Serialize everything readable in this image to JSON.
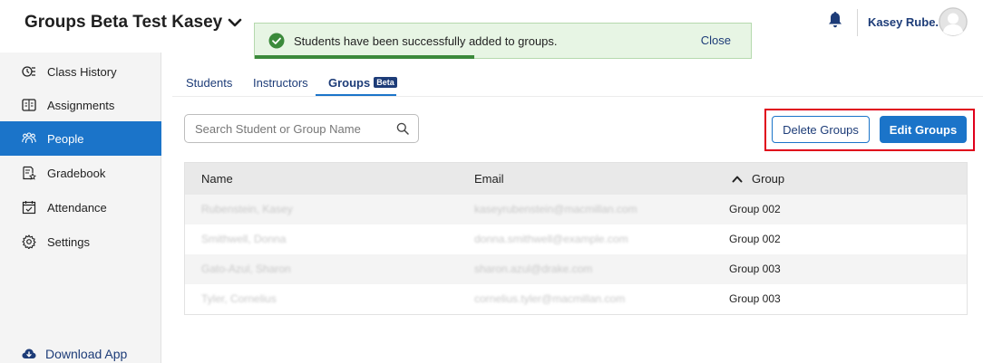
{
  "header": {
    "course_title": "Groups Beta Test Kasey",
    "user_name": "Kasey Rube..."
  },
  "toast": {
    "message": "Students have been successfully added to groups.",
    "close_label": "Close"
  },
  "sidebar": {
    "items": [
      {
        "label": "Class History",
        "icon": "class-history-icon",
        "active": false
      },
      {
        "label": "Assignments",
        "icon": "assignments-icon",
        "active": false
      },
      {
        "label": "People",
        "icon": "people-icon",
        "active": true
      },
      {
        "label": "Gradebook",
        "icon": "gradebook-icon",
        "active": false
      },
      {
        "label": "Attendance",
        "icon": "calendar-icon",
        "active": false
      },
      {
        "label": "Settings",
        "icon": "gear-icon",
        "active": false
      }
    ],
    "download_label": "Download App"
  },
  "tabs": {
    "students": "Students",
    "instructors": "Instructors",
    "groups": "Groups",
    "beta_badge": "Beta",
    "active": "groups"
  },
  "search": {
    "placeholder": "Search Student or Group Name",
    "value": ""
  },
  "actions": {
    "delete_label": "Delete Groups",
    "edit_label": "Edit Groups"
  },
  "table": {
    "columns": {
      "name": "Name",
      "email": "Email",
      "group": "Group"
    },
    "sort": {
      "column": "group",
      "direction": "ascending"
    },
    "rows": [
      {
        "name": "Rubenstein, Kasey",
        "email": "kaseyrubenstein@macmillan.com",
        "group": "Group 002"
      },
      {
        "name": "Smithwell, Donna",
        "email": "donna.smithwell@example.com",
        "group": "Group 002"
      },
      {
        "name": "Gato-Azul, Sharon",
        "email": "sharon.azul@drake.com",
        "group": "Group 003"
      },
      {
        "name": "Tyler, Cornelius",
        "email": "cornelius.tyler@macmillan.com",
        "group": "Group 003"
      }
    ]
  },
  "colors": {
    "primary": "#1b74c9",
    "navy": "#1d3c78",
    "toast_bg": "#e7f5e4",
    "toast_success": "#3b8a3b",
    "highlight": "#e0001b"
  }
}
